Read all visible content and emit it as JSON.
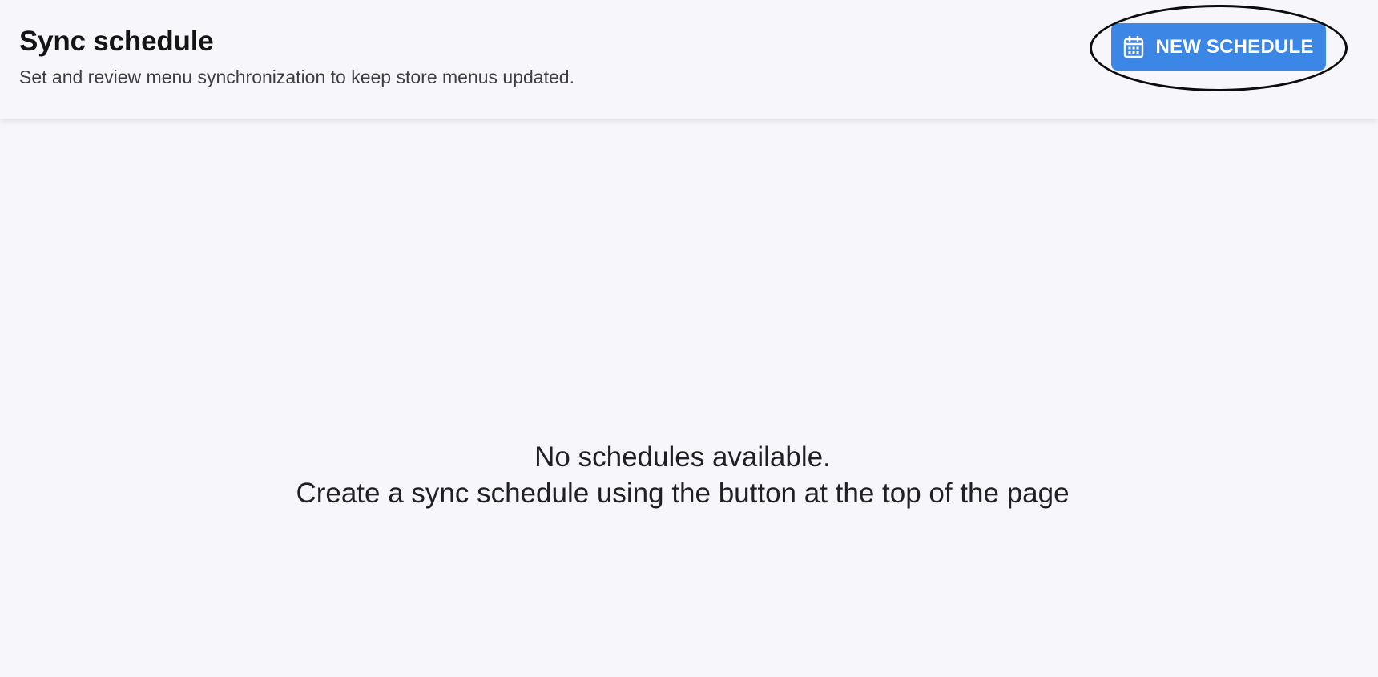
{
  "header": {
    "title": "Sync schedule",
    "subtitle": "Set and review menu synchronization to keep store menus updated.",
    "new_schedule_label": "NEW SCHEDULE",
    "new_schedule_icon": "calendar-icon"
  },
  "empty_state": {
    "line1": "No schedules available.",
    "line2": "Create a sync schedule using the button at the top of the page"
  },
  "colors": {
    "background": "#f7f7fb",
    "accent": "#3c86e6",
    "button_text": "#ffffff",
    "annotation_ring": "#0c0c0c"
  }
}
